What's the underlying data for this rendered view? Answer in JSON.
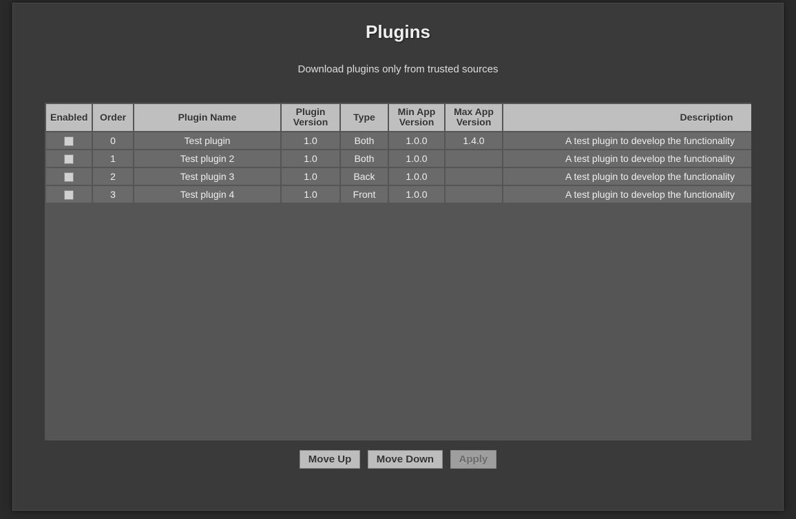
{
  "dialog": {
    "title": "Plugins",
    "subtitle": "Download plugins only from trusted sources"
  },
  "table": {
    "headers": {
      "enabled": "Enabled",
      "order": "Order",
      "name": "Plugin Name",
      "version": "Plugin Version",
      "type": "Type",
      "minapp": "Min App Version",
      "maxapp": "Max App Version",
      "desc": "Description"
    },
    "rows": [
      {
        "enabled": false,
        "order": "0",
        "name": "Test plugin",
        "version": "1.0",
        "type": "Both",
        "minapp": "1.0.0",
        "maxapp": "1.4.0",
        "desc": "A test plugin to develop the functionality"
      },
      {
        "enabled": false,
        "order": "1",
        "name": "Test plugin 2",
        "version": "1.0",
        "type": "Both",
        "minapp": "1.0.0",
        "maxapp": "",
        "desc": "A test plugin to develop the functionality"
      },
      {
        "enabled": false,
        "order": "2",
        "name": "Test plugin 3",
        "version": "1.0",
        "type": "Back",
        "minapp": "1.0.0",
        "maxapp": "",
        "desc": "A test plugin to develop the functionality"
      },
      {
        "enabled": false,
        "order": "3",
        "name": "Test plugin 4",
        "version": "1.0",
        "type": "Front",
        "minapp": "1.0.0",
        "maxapp": "",
        "desc": "A test plugin to develop the functionality"
      }
    ]
  },
  "buttons": {
    "move_up": "Move Up",
    "move_down": "Move Down",
    "apply": "Apply"
  }
}
